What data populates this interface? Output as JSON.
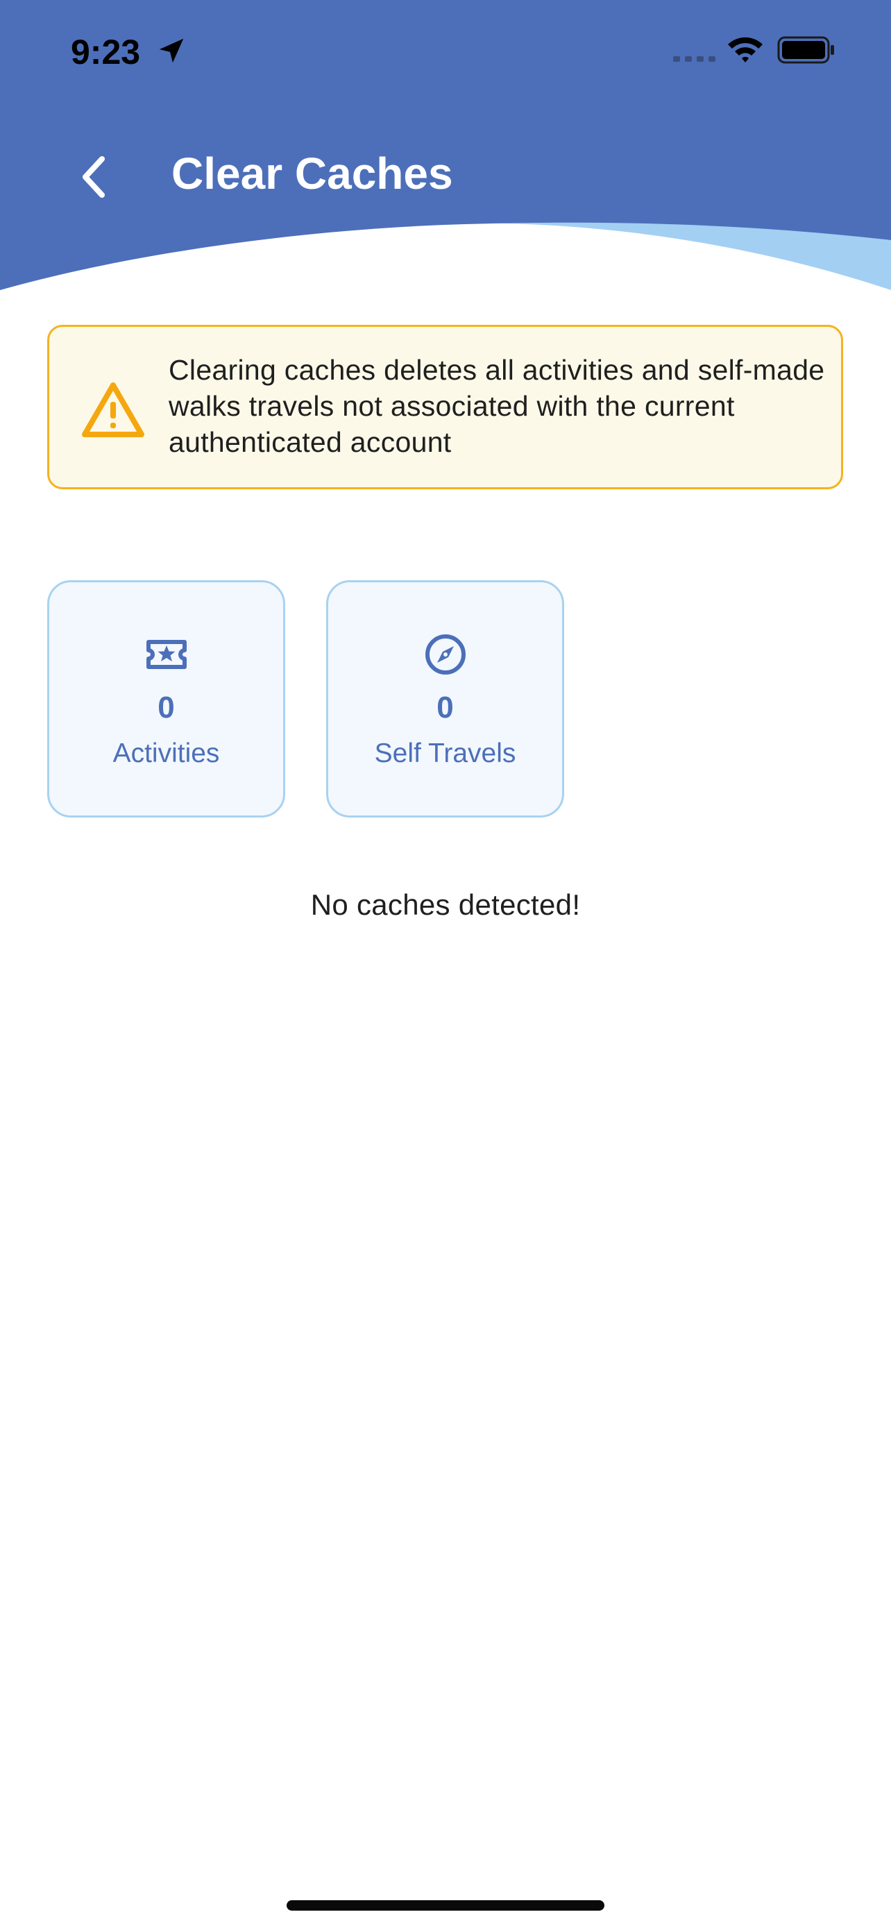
{
  "status_bar": {
    "time": "9:23",
    "icons": [
      "location-arrow-icon",
      "cellular-signal-icon",
      "wifi-icon",
      "battery-icon"
    ]
  },
  "header": {
    "title": "Clear Caches",
    "back_icon": "chevron-left-icon",
    "colors": {
      "primary": "#4d6fba",
      "wave_accent": "#a3cff3"
    }
  },
  "warning": {
    "icon": "warning-triangle-icon",
    "text": "Clearing caches deletes all activities and self-made walks travels not associated with the current authenticated account",
    "colors": {
      "border": "#f5b21e",
      "background": "#fdf9e9",
      "icon": "#f5a70f"
    }
  },
  "cards": [
    {
      "icon": "ticket-star-icon",
      "count": "0",
      "label": "Activities"
    },
    {
      "icon": "compass-icon",
      "count": "0",
      "label": "Self Travels"
    }
  ],
  "empty_message": "No caches detected!"
}
